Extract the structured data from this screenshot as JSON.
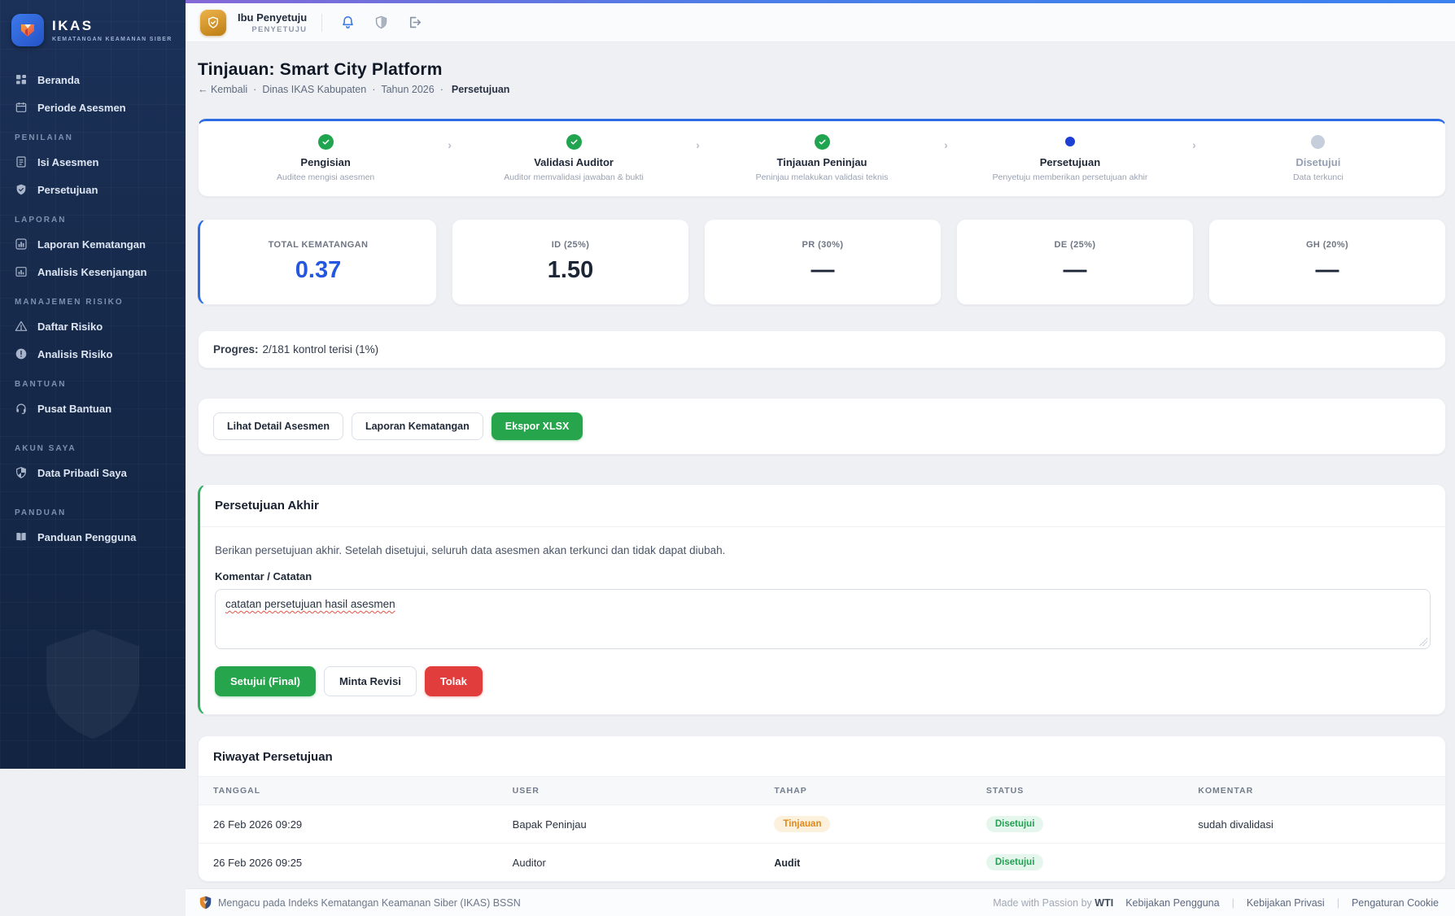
{
  "brand": {
    "name": "IKAS",
    "subtitle": "KEMATANGAN KEAMANAN SIBER"
  },
  "sidebar": {
    "sections": [
      {
        "label": "",
        "items": [
          {
            "label": "Beranda"
          },
          {
            "label": "Periode Asesmen"
          }
        ]
      },
      {
        "label": "PENILAIAN",
        "items": [
          {
            "label": "Isi Asesmen"
          },
          {
            "label": "Persetujuan"
          }
        ]
      },
      {
        "label": "LAPORAN",
        "items": [
          {
            "label": "Laporan Kematangan"
          },
          {
            "label": "Analisis Kesenjangan"
          }
        ]
      },
      {
        "label": "MANAJEMEN RISIKO",
        "items": [
          {
            "label": "Daftar Risiko"
          },
          {
            "label": "Analisis Risiko"
          }
        ]
      },
      {
        "label": "BANTUAN",
        "items": [
          {
            "label": "Pusat Bantuan"
          }
        ]
      },
      {
        "label": "AKUN SAYA",
        "items": [
          {
            "label": "Data Pribadi Saya"
          }
        ]
      },
      {
        "label": "PANDUAN",
        "items": [
          {
            "label": "Panduan Pengguna"
          }
        ]
      }
    ]
  },
  "header": {
    "user_name": "Ibu Penyetuju",
    "user_role": "PENYETUJU"
  },
  "page": {
    "title": "Tinjauan: Smart City Platform",
    "breadcrumb": {
      "back": "← Kembali",
      "sep": "·",
      "org": "Dinas IKAS Kabupaten",
      "period": "Tahun 2026",
      "current": "Persetujuan"
    }
  },
  "stepper": [
    {
      "title": "Pengisian",
      "subtitle": "Auditee mengisi asesmen",
      "state": "done"
    },
    {
      "title": "Validasi Auditor",
      "subtitle": "Auditor memvalidasi jawaban & bukti",
      "state": "done"
    },
    {
      "title": "Tinjauan Peninjau",
      "subtitle": "Peninjau melakukan validasi teknis",
      "state": "done"
    },
    {
      "title": "Persetujuan",
      "subtitle": "Penyetuju memberikan persetujuan akhir",
      "state": "active"
    },
    {
      "title": "Disetujui",
      "subtitle": "Data terkunci",
      "state": "pending"
    }
  ],
  "score_cards": [
    {
      "label": "TOTAL KEMATANGAN",
      "value": "0.37"
    },
    {
      "label": "ID (25%)",
      "value": "1.50"
    },
    {
      "label": "PR (30%)",
      "value": "—"
    },
    {
      "label": "DE (25%)",
      "value": "—"
    },
    {
      "label": "GH (20%)",
      "value": "—"
    }
  ],
  "progress": {
    "label": "Progres:",
    "text": "2/181 kontrol terisi (1%)"
  },
  "actions": {
    "detail": "Lihat Detail Asesmen",
    "report": "Laporan Kematangan",
    "export": "Ekspor XLSX"
  },
  "approval": {
    "title": "Persetujuan Akhir",
    "description": "Berikan persetujuan akhir. Setelah disetujui, seluruh data asesmen akan terkunci dan tidak dapat diubah.",
    "comment_label": "Komentar / Catatan",
    "comment_value": "catatan persetujuan hasil asesmen",
    "approve_label": "Setujui (Final)",
    "revise_label": "Minta Revisi",
    "reject_label": "Tolak"
  },
  "history": {
    "title": "Riwayat Persetujuan",
    "columns": [
      "TANGGAL",
      "USER",
      "TAHAP",
      "STATUS",
      "KOMENTAR"
    ],
    "rows": [
      {
        "date": "26 Feb 2026 09:29",
        "user": "Bapak Peninjau",
        "stage": "Tinjauan",
        "status": "Disetujui",
        "comment": "sudah divalidasi"
      },
      {
        "date": "26 Feb 2026 09:25",
        "user": "Auditor",
        "stage": "Audit",
        "status": "Disetujui",
        "comment": ""
      }
    ]
  },
  "footer": {
    "left_text": "Mengacu pada Indeks Kematangan Keamanan Siber (IKAS) BSSN",
    "made_prefix": "Made with Passion by",
    "made_brand": "WTI",
    "sep": "|",
    "links": [
      "Kebijakan Pengguna",
      "Kebijakan Privasi",
      "Pengaturan Cookie"
    ]
  },
  "colors": {
    "accent_blue": "#2e6ce4",
    "success_green": "#27a54d",
    "danger_red": "#e23d3d",
    "amber_badge": "#e0881c",
    "sidebar_navy": "#16294a"
  }
}
